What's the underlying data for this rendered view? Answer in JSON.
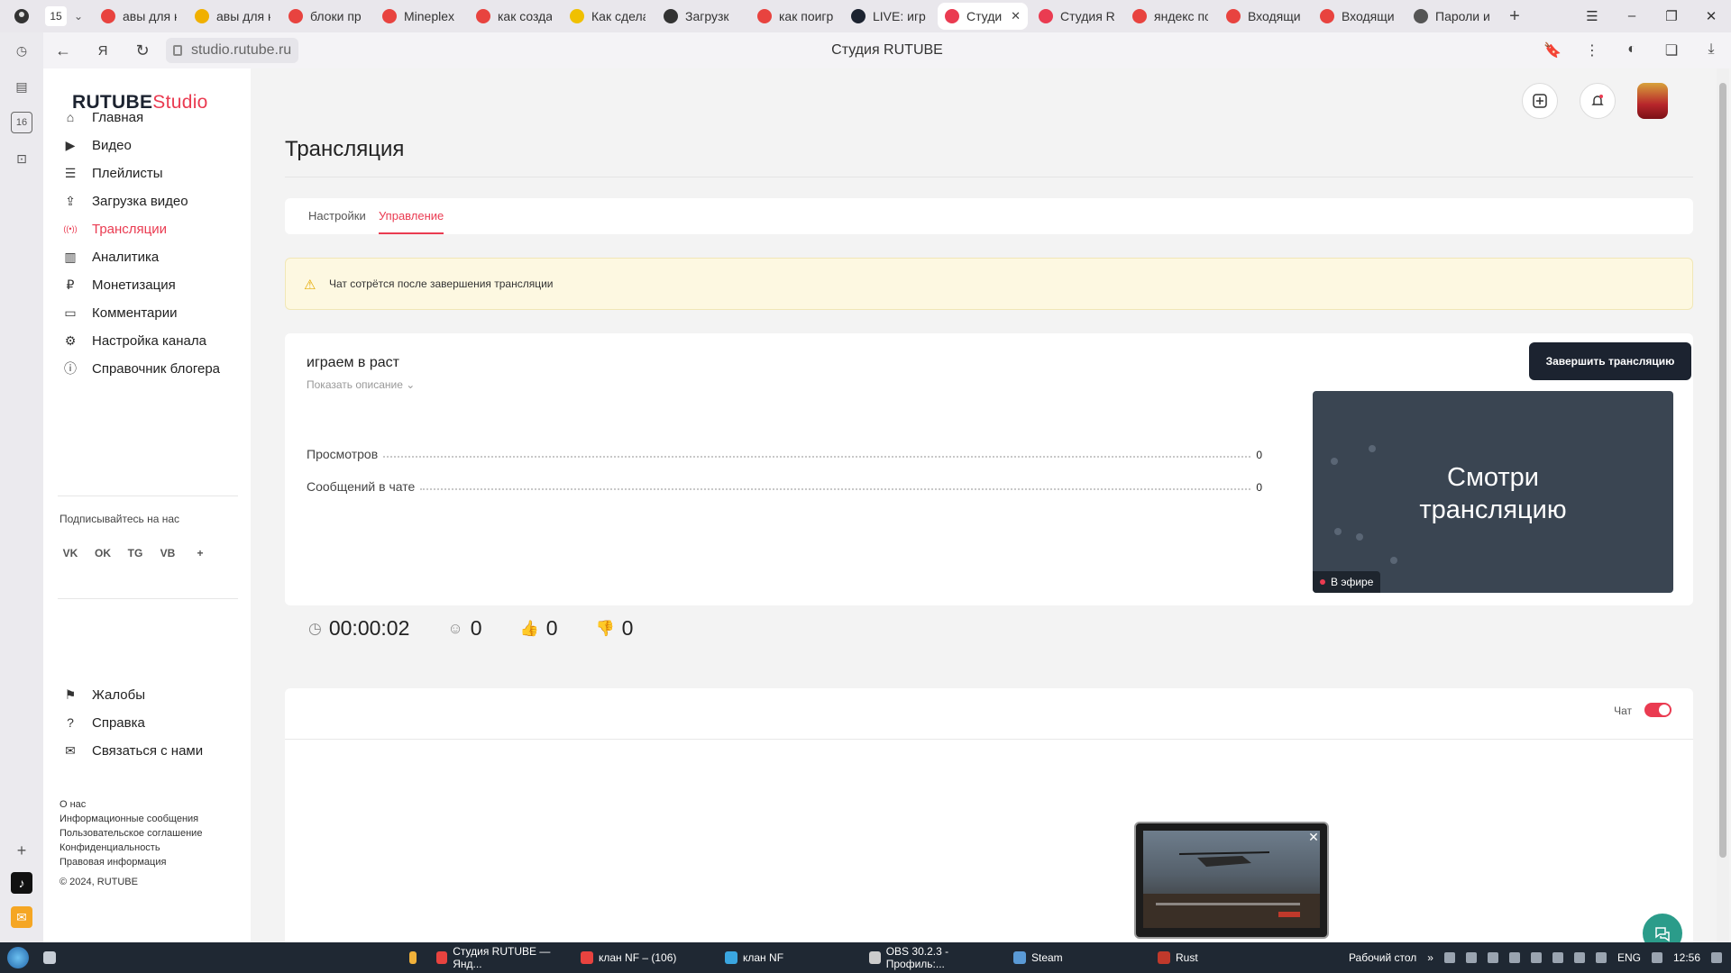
{
  "browser": {
    "tab_count": "15",
    "tabs": [
      {
        "label": "авы для к",
        "color": "#e8433f"
      },
      {
        "label": "авы для к",
        "color": "#f0b000"
      },
      {
        "label": "блоки пр",
        "color": "#e8433f"
      },
      {
        "label": "Minepleх",
        "color": "#e8433f"
      },
      {
        "label": "как созда",
        "color": "#e8433f"
      },
      {
        "label": "Как сдела",
        "color": "#f0c000"
      },
      {
        "label": "Загрузк",
        "color": "#333333"
      },
      {
        "label": "как поигр",
        "color": "#e8433f"
      },
      {
        "label": "LIVE: игр",
        "color": "#1c2330"
      },
      {
        "label": "Студи",
        "color": "#ea3b51",
        "active": true
      },
      {
        "label": "Студия R",
        "color": "#ea3b51"
      },
      {
        "label": "яндекс пс",
        "color": "#e8433f"
      },
      {
        "label": "Входящи",
        "color": "#e8433f"
      },
      {
        "label": "Входящи",
        "color": "#e8433f"
      },
      {
        "label": "Пароли и",
        "color": "#555555"
      }
    ],
    "url": "studio.rutube.ru",
    "page_title": "Студия RUTUBE"
  },
  "rail": {
    "badge": "16"
  },
  "sidebar": {
    "logo_main": "RUTUBE",
    "logo_studio": "Studio",
    "items": [
      {
        "label": "Главная",
        "icon": "home-icon"
      },
      {
        "label": "Видео",
        "icon": "video-icon"
      },
      {
        "label": "Плейлисты",
        "icon": "playlist-icon"
      },
      {
        "label": "Загрузка видео",
        "icon": "upload-icon"
      },
      {
        "label": "Трансляции",
        "icon": "broadcast-icon",
        "active": true
      },
      {
        "label": "Аналитика",
        "icon": "analytics-icon"
      },
      {
        "label": "Монетизация",
        "icon": "monetization-icon"
      },
      {
        "label": "Комментарии",
        "icon": "comments-icon"
      },
      {
        "label": "Настройка канала",
        "icon": "settings-icon"
      },
      {
        "label": "Справочник блогера",
        "icon": "guide-icon"
      }
    ],
    "follow_title": "Подписывайтесь на нас",
    "socials": [
      "VK",
      "OK",
      "TG",
      "VB",
      "+"
    ],
    "bottom_items": [
      {
        "label": "Жалобы",
        "icon": "flag-icon"
      },
      {
        "label": "Справка",
        "icon": "help-icon"
      },
      {
        "label": "Связаться с нами",
        "icon": "mail-icon"
      }
    ],
    "small_links": [
      "О нас",
      "Информационные сообщения",
      "Пользовательское соглашение",
      "Конфиденциальность",
      "Правовая информация"
    ],
    "copyright": "© 2024, RUTUBE"
  },
  "main": {
    "heading": "Трансляция",
    "tabs": [
      {
        "label": "Настройки"
      },
      {
        "label": "Управление",
        "active": true
      }
    ],
    "warning": "Чат сотрётся после завершения трансляции",
    "stream": {
      "title": "играем в раст",
      "show_description": "Показать описание",
      "stats": [
        {
          "label": "Просмотров",
          "value": "0"
        },
        {
          "label": "Сообщений в чате",
          "value": "0"
        }
      ],
      "preview_text_line1": "Смотри",
      "preview_text_line2": "трансляцию",
      "live_badge": "В эфире",
      "end_button": "Завершить трансляцию",
      "timer": "00:00:02",
      "viewers": "0",
      "likes": "0",
      "dislikes": "0"
    },
    "chat_label": "Чат",
    "chat_enabled": true
  },
  "taskbar": {
    "apps": [
      {
        "label": "",
        "color": "#f0b13a"
      },
      {
        "label": "Студия RUTUBE — Янд...",
        "color": "#e8433f"
      },
      {
        "label": "клан NF – (106)",
        "color": "#e8433f"
      },
      {
        "label": "клан NF",
        "color": "#3aa6e0"
      },
      {
        "label": "OBS 30.2.3 - Профиль:...",
        "color": "#cccccc"
      },
      {
        "label": "Steam",
        "color": "#5a9ad6"
      },
      {
        "label": "Rust",
        "color": "#c0392b"
      }
    ],
    "desktop_label": "Рабочий стол",
    "lang": "ENG",
    "time": "12:56"
  }
}
